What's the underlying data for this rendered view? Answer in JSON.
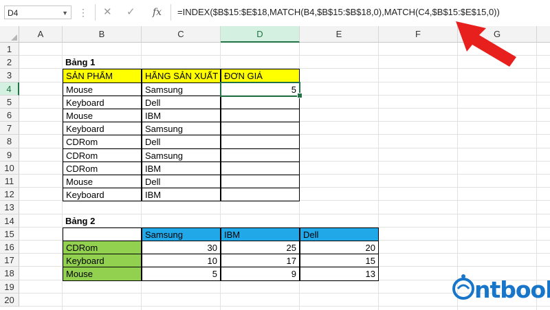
{
  "namebox": "D4",
  "formula_bar": {
    "cancel_icon": "x-icon",
    "enter_icon": "check-icon",
    "fx_label": "fx",
    "formula": "=INDEX($B$15:$E$18,MATCH(B4,$B$15:$B$18,0),MATCH(C4,$B$15:$E$15,0))"
  },
  "columns": [
    "A",
    "B",
    "C",
    "D",
    "E",
    "F",
    "G",
    "H"
  ],
  "active_column": "D",
  "rows": [
    "1",
    "2",
    "3",
    "4",
    "5",
    "6",
    "7",
    "8",
    "9",
    "10",
    "11",
    "12",
    "13",
    "14",
    "15",
    "16",
    "17",
    "18",
    "19",
    "20"
  ],
  "active_row": "4",
  "table1": {
    "title": "Bảng 1",
    "headers": [
      "SẢN PHẨM",
      "HÃNG SẢN XUẤT",
      "ĐƠN GIÁ"
    ],
    "rows": [
      [
        "Mouse",
        "Samsung",
        "5"
      ],
      [
        "Keyboard",
        "Dell",
        ""
      ],
      [
        "Mouse",
        "IBM",
        ""
      ],
      [
        "Keyboard",
        "Samsung",
        ""
      ],
      [
        "CDRom",
        "Dell",
        ""
      ],
      [
        "CDRom",
        "Samsung",
        ""
      ],
      [
        "CDRom",
        "IBM",
        ""
      ],
      [
        "Mouse",
        "Dell",
        ""
      ],
      [
        "Keyboard",
        "IBM",
        ""
      ]
    ]
  },
  "table2": {
    "title": "Bảng 2",
    "headers": [
      "",
      "Samsung",
      "IBM",
      "Dell"
    ],
    "rows": [
      [
        "CDRom",
        "30",
        "25",
        "20"
      ],
      [
        "Keyboard",
        "10",
        "17",
        "15"
      ],
      [
        "Mouse",
        "5",
        "9",
        "13"
      ]
    ]
  },
  "logo_text": "ntbook",
  "colors": {
    "yellow_header": "#ffff00",
    "blue_header": "#20a8e8",
    "green_rowlabel": "#92d050",
    "selection": "#217346",
    "arrow": "#e8201d",
    "logo": "#1776c9"
  }
}
